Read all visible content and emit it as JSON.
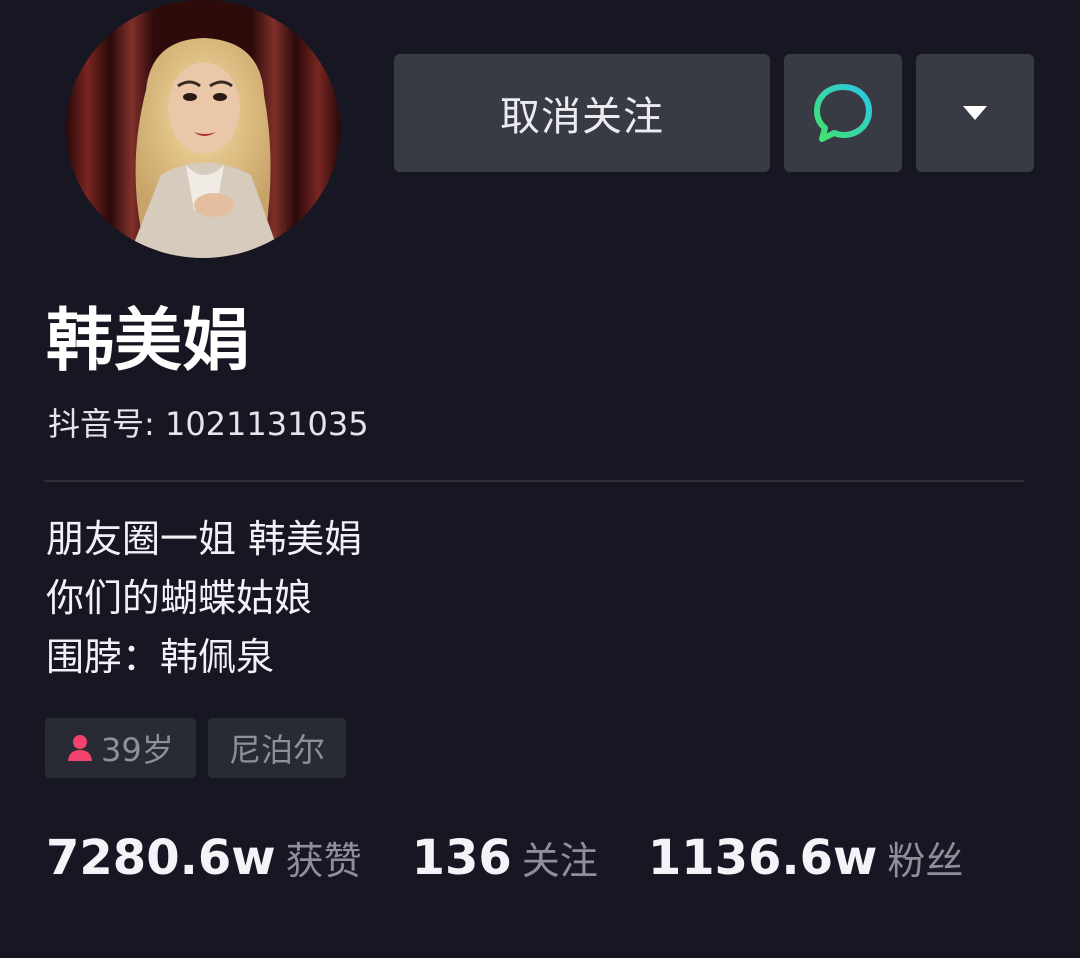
{
  "profile": {
    "nickname": "韩美娟",
    "douyin_id": "抖音号: 1021131035",
    "avatar_icon": "avatar-photo"
  },
  "actions": {
    "unfollow_label": "取消关注",
    "chat_icon": "chat-bubble-icon",
    "more_icon": "triangle-down-icon"
  },
  "bio": {
    "lines": [
      "朋友圈一姐 韩美娟",
      "你们的蝴蝶姑娘",
      "围脖：韩佩泉"
    ]
  },
  "tags": {
    "age": "39岁",
    "age_icon": "person-icon",
    "region": "尼泊尔"
  },
  "stats": {
    "likes": {
      "value": "7280.6w",
      "label": "获赞"
    },
    "following": {
      "value": "136",
      "label": "关注"
    },
    "followers": {
      "value": "1136.6w",
      "label": "粉丝"
    }
  },
  "colors": {
    "background": "#161722",
    "button": "#393b44",
    "tag": "#282a34",
    "muted_text": "#8e8f9a",
    "chat_green": "#35e08a",
    "chat_cyan": "#2dc9e6",
    "age_icon_pink": "#f0426d"
  }
}
